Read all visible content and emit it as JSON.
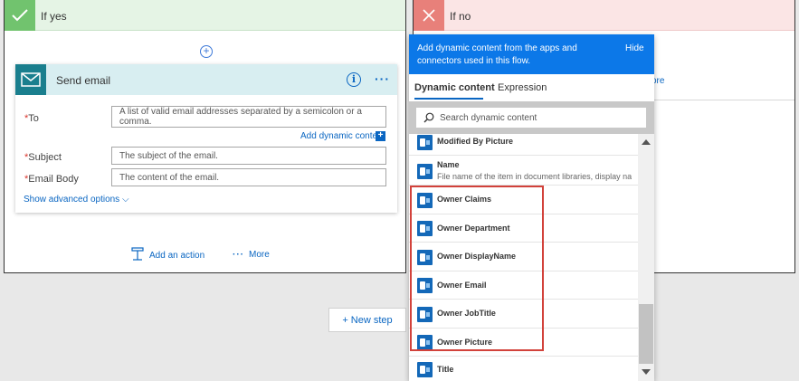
{
  "if_yes": {
    "title": "If yes"
  },
  "if_no": {
    "title": "If no",
    "behind_link_fragment": "ore"
  },
  "send_email": {
    "title": "Send email",
    "to_label": "To",
    "to_placeholder": "A list of valid email addresses separated by a semicolon or a comma.",
    "add_dynamic_label": "Add dynamic content",
    "subject_label": "Subject",
    "subject_placeholder": "The subject of the email.",
    "body_label": "Email Body",
    "body_placeholder": "The content of the email.",
    "advanced_label": "Show advanced options"
  },
  "actions": {
    "add_action": "Add an action",
    "more": "More",
    "new_step": "+ New step"
  },
  "dynamic_panel": {
    "header_text": "Add dynamic content from the apps and connectors used in this flow.",
    "hide_label": "Hide",
    "tabs": {
      "dynamic": "Dynamic content",
      "expression": "Expression"
    },
    "search_placeholder": "Search dynamic content",
    "items": [
      {
        "label": "Modified By Picture"
      },
      {
        "label": "Name",
        "desc": "File name of the item in document libraries, display na..."
      },
      {
        "label": "Owner Claims"
      },
      {
        "label": "Owner Department"
      },
      {
        "label": "Owner DisplayName"
      },
      {
        "label": "Owner Email"
      },
      {
        "label": "Owner JobTitle"
      },
      {
        "label": "Owner Picture"
      },
      {
        "label": "Title"
      }
    ]
  },
  "colors": {
    "accent": "#0a66c2",
    "panel_header": "#0c78e8",
    "yes_header": "#e5f4e5",
    "no_header": "#fbe5e5",
    "highlight": "#d2423b"
  }
}
